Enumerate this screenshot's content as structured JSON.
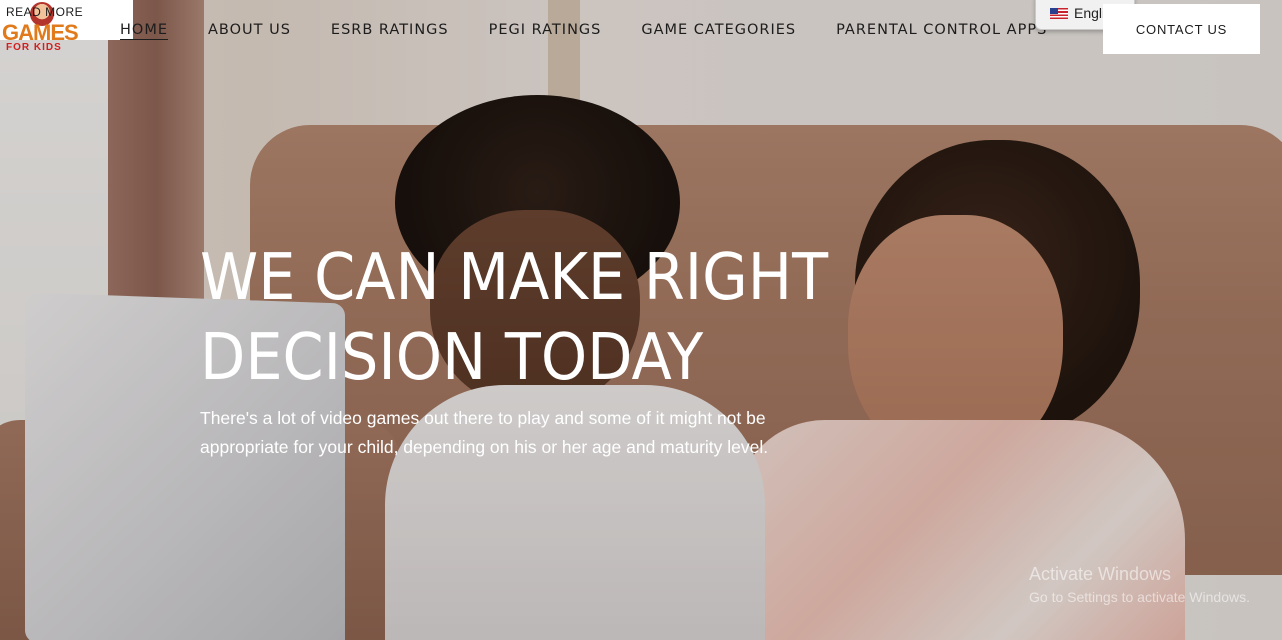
{
  "logo": {
    "overlay_text": "READ MORE",
    "word": "GAMES",
    "sub": "FOR KIDS"
  },
  "nav": {
    "items": [
      {
        "label": "HOME",
        "active": true
      },
      {
        "label": "ABOUT US",
        "active": false
      },
      {
        "label": "ESRB RATINGS",
        "active": false
      },
      {
        "label": "PEGI RATINGS",
        "active": false
      },
      {
        "label": "GAME CATEGORIES",
        "active": false
      },
      {
        "label": "PARENTAL CONTROL APPS",
        "active": false
      }
    ],
    "contact_label": "CONTACT US"
  },
  "language": {
    "label": "English",
    "flag_icon": "us-flag-icon"
  },
  "hero": {
    "headline_line1": "WE CAN MAKE RIGHT",
    "headline_line2": "DECISION TODAY",
    "subtext": "There's a lot of video games out there to play and some of it might not be appropriate for your child, depending on his or her age and maturity level."
  },
  "watermark": {
    "title": "Activate Windows",
    "subtitle": "Go to Settings to activate Windows."
  },
  "colors": {
    "text_light": "#ffffff",
    "nav_text": "#1d1d1d",
    "logo_orange": "#e07a1b",
    "logo_red": "#d11f1f"
  }
}
